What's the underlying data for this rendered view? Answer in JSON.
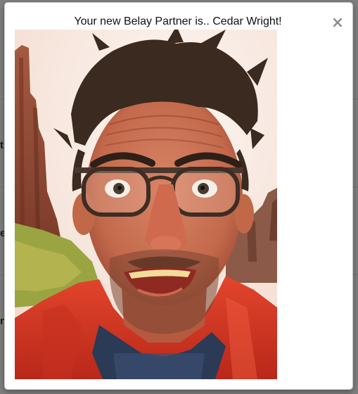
{
  "modal": {
    "title": "Your new Belay Partner is.. Cedar Wright!",
    "close_label": "×",
    "photo_alt": "Cedar Wright"
  },
  "background_page": {
    "fragments": [
      "t",
      "e",
      "n"
    ]
  }
}
